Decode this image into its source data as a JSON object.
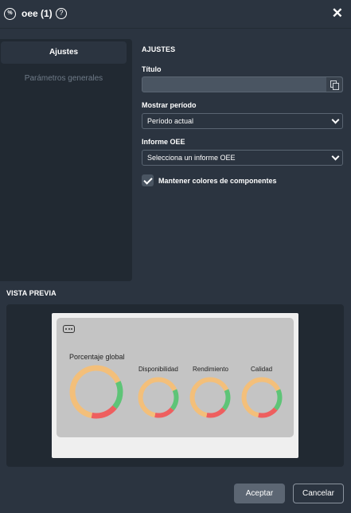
{
  "window": {
    "title": "oee (1)",
    "app_icon_text": "%",
    "help_icon": "?",
    "close_icon": "✕"
  },
  "sidebar": {
    "active_tab": "Ajustes",
    "items": [
      {
        "label": "Parámetros generales"
      }
    ]
  },
  "settings": {
    "section_title": "AJUSTES",
    "title_label": "Título",
    "title_value": "",
    "period_label": "Mostrar período",
    "period_selected": "Período actual",
    "report_label": "Informe OEE",
    "report_selected": "Selecciona un informe OEE",
    "keep_colors_label": "Mantener colores de componentes",
    "keep_colors_checked": true
  },
  "preview": {
    "section_title": "VISTA PREVIA",
    "gauges": [
      {
        "label": "Porcentaje global",
        "green": 0.18,
        "red": 0.17,
        "orange": 0.65
      },
      {
        "label": "Disponibilidad",
        "green": 0.18,
        "red": 0.17,
        "orange": 0.65
      },
      {
        "label": "Rendimiento",
        "green": 0.18,
        "red": 0.17,
        "orange": 0.65
      },
      {
        "label": "Calidad",
        "green": 0.18,
        "red": 0.17,
        "orange": 0.65
      }
    ],
    "colors": {
      "green": "#5ec477",
      "red": "#ee5f5f",
      "orange": "#f3bf7a"
    }
  },
  "footer": {
    "accept_label": "Aceptar",
    "cancel_label": "Cancelar"
  }
}
